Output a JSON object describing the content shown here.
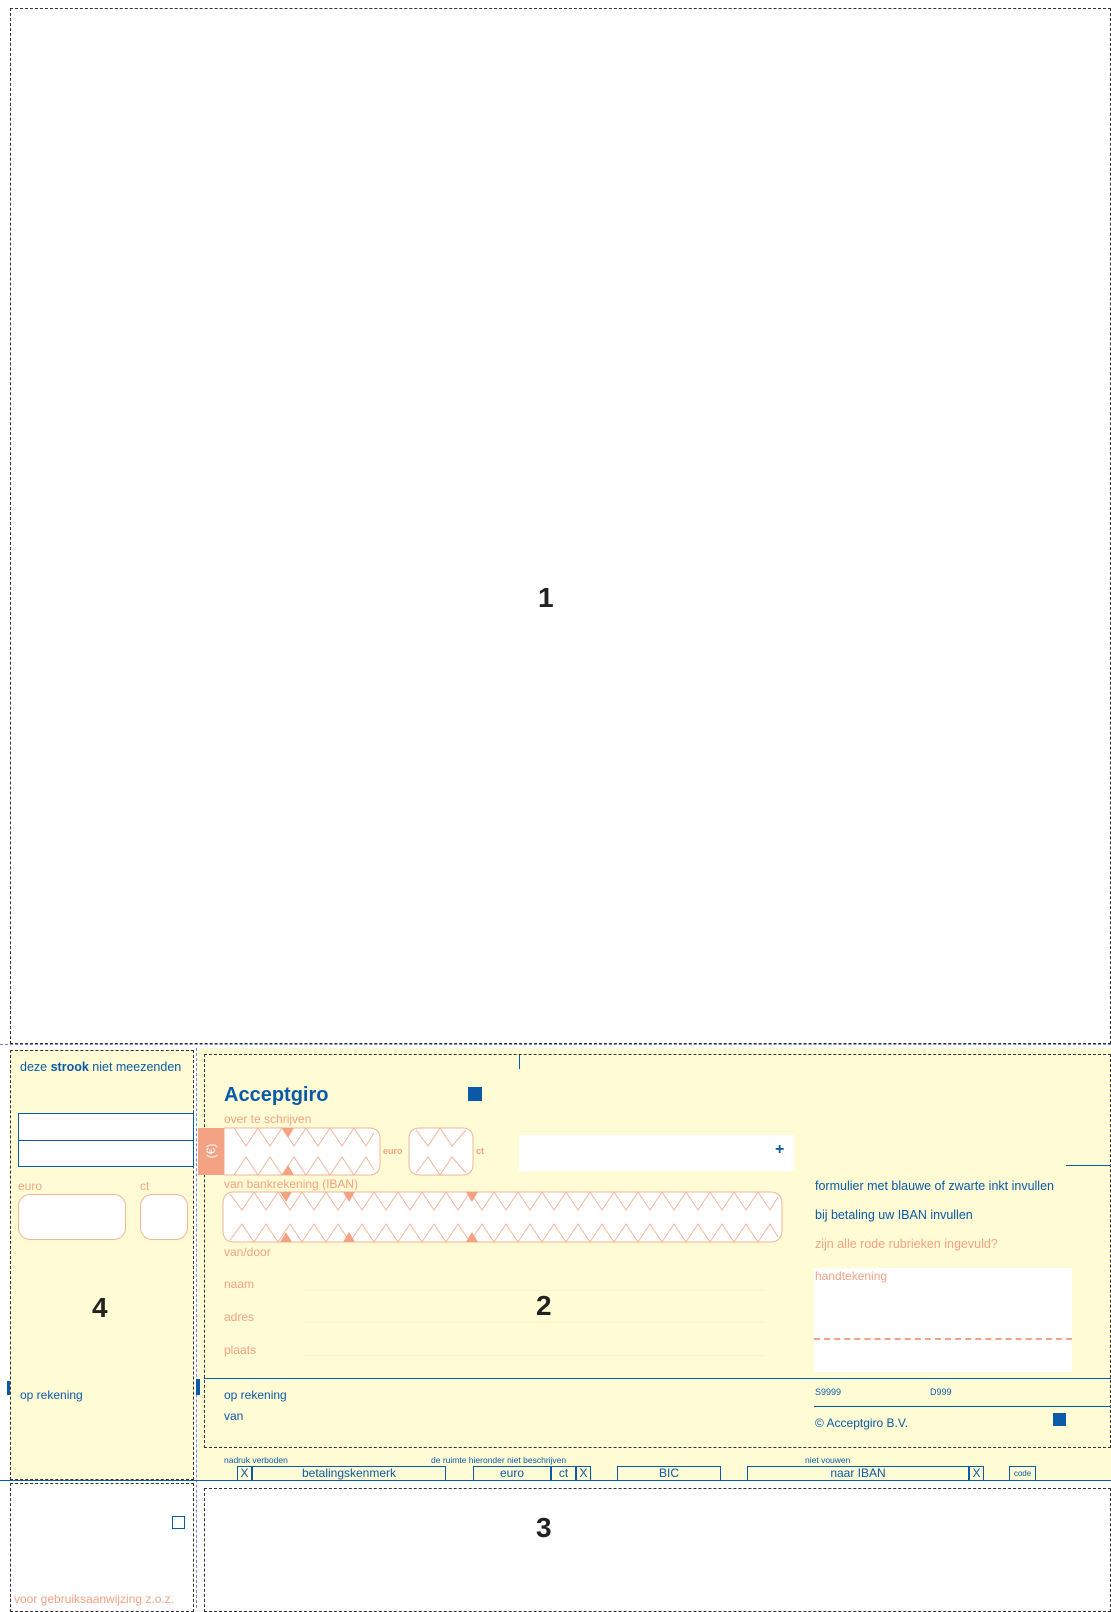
{
  "sections": {
    "one": "1",
    "two": "2",
    "three": "3",
    "four": "4"
  },
  "stub": {
    "header_pre": "deze ",
    "header_bold": "strook",
    "header_post": " niet meezenden",
    "euro_label": "euro",
    "ct_label": "ct",
    "op_rekening": "op rekening",
    "instructions": "voor gebruiksaanwijzing z.o.z."
  },
  "main": {
    "title": "Acceptgiro",
    "over_te_schrijven": "over te schrijven",
    "euro_symbol": "(€)",
    "euro_small": "euro",
    "ct_small": "ct",
    "plus": "+",
    "van_bankrekening": "van bankrekening (IBAN)",
    "van_door": "van/door",
    "naam": "naam",
    "adres": "adres",
    "plaats": "plaats",
    "op_rekening": "op rekening",
    "van": "van"
  },
  "right_panel": {
    "instr1": "formulier met blauwe of zwarte inkt invullen",
    "instr2": "bij betaling uw IBAN invullen",
    "instr3": "zijn alle rode rubrieken ingevuld?",
    "handtekening": "handtekening",
    "code_s": "S9999",
    "code_d": "D999",
    "copyright": "© Acceptgiro B.V."
  },
  "codeline": {
    "nadruk": "nadruk verboden",
    "ruimte": "de ruimte hieronder niet beschrijven",
    "vouwen": "niet vouwen",
    "x1": "X",
    "betalingskenmerk": "betalingskenmerk",
    "euro": "euro",
    "ct": "ct",
    "x2": "X",
    "bic": "BIC",
    "naar_iban": "naar IBAN",
    "x3": "X",
    "code": "code"
  },
  "colors": {
    "blue": "#0b5aa8",
    "salmon": "#f3a383",
    "yellow": "#fffbd4"
  }
}
